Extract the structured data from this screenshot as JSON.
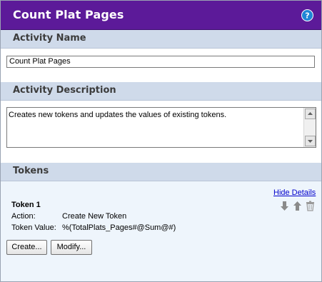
{
  "header": {
    "title": "Count Plat Pages",
    "help_icon": "help-icon"
  },
  "activity_name": {
    "label": "Activity Name",
    "value": "Count Plat Pages"
  },
  "activity_description": {
    "label": "Activity Description",
    "value": "Creates new tokens and updates the values of existing tokens."
  },
  "tokens": {
    "label": "Tokens",
    "hide_details": "Hide Details",
    "items": [
      {
        "title": "Token 1",
        "action_label": "Action:",
        "action_value": "Create New Token",
        "value_label": "Token Value:",
        "value_value": "%(TotalPlats_Pages#@Sum@#)"
      }
    ],
    "create_button": "Create...",
    "modify_button": "Modify..."
  },
  "colors": {
    "title_bar": "#5c1a99",
    "section_header": "#cfdaea",
    "tokens_bg": "#eef5fc",
    "link": "#0000cc",
    "help_icon": "#1f86d6"
  }
}
